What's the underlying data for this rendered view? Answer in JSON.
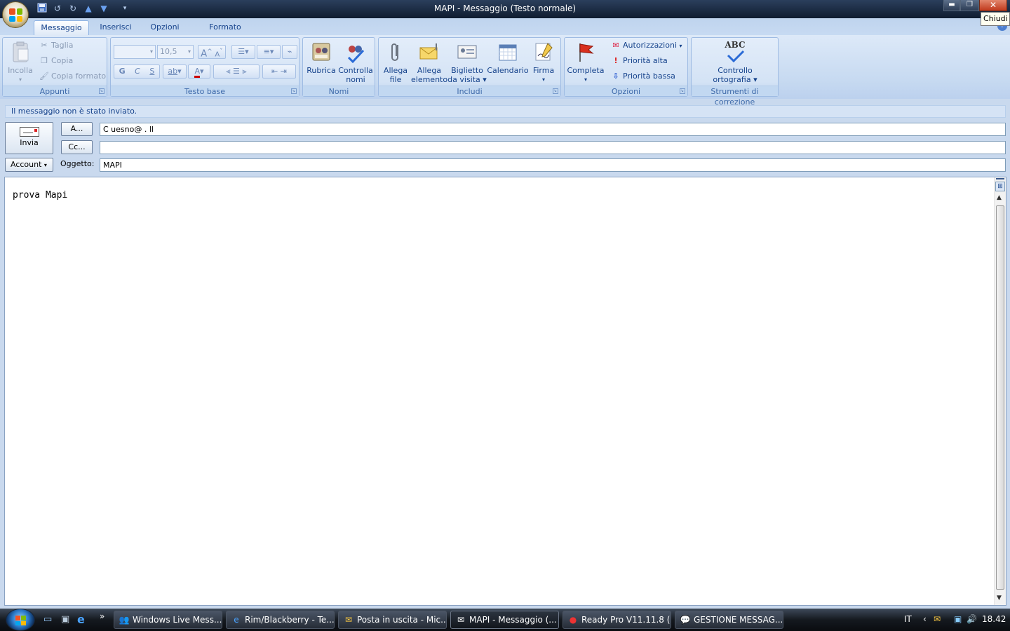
{
  "window": {
    "title": "MAPI - Messaggio (Testo normale)",
    "tooltip": "Chiudi",
    "help_icon": "help-icon"
  },
  "quick_access": [
    "save-icon",
    "undo-icon",
    "redo-icon",
    "up-arrow-icon",
    "down-arrow-icon",
    "customize-icon"
  ],
  "tabs": [
    {
      "label": "Messaggio",
      "active": true
    },
    {
      "label": "Inserisci"
    },
    {
      "label": "Opzioni"
    },
    {
      "label": "Formato testo"
    }
  ],
  "ribbon": {
    "appunti": {
      "label": "Appunti",
      "paste": "Incolla",
      "cut": "Taglia",
      "copy": "Copia",
      "format_painter": "Copia formato"
    },
    "testo_base": {
      "label": "Testo base",
      "font_name": "",
      "font_size": "10,5",
      "bold": "G",
      "italic": "C",
      "strike": "S",
      "grow": "A",
      "shrink": "A",
      "highlight": "ab",
      "font_color": "A"
    },
    "nomi": {
      "label": "Nomi",
      "address_book": "Rubrica",
      "check_names_1": "Controlla",
      "check_names_2": "nomi"
    },
    "includi": {
      "label": "Includi",
      "attach_file_1": "Allega",
      "attach_file_2": "file",
      "attach_item_1": "Allega",
      "attach_item_2": "elemento",
      "business_card_1": "Biglietto",
      "business_card_2": "da visita",
      "calendar": "Calendario",
      "signature": "Firma"
    },
    "opzioni": {
      "label": "Opzioni",
      "follow_up": "Completa",
      "permissions": "Autorizzazioni",
      "high_priority": "Priorità alta",
      "low_priority": "Priorità bassa"
    },
    "correzione": {
      "label": "Strumenti di correzione",
      "abc": "ABC",
      "spelling_1": "Controllo",
      "spelling_2": "ortografia"
    }
  },
  "info_bar": "Il messaggio non è stato inviato.",
  "form": {
    "send": "Invia",
    "to_button": "A...",
    "cc_button": "Cc...",
    "account_button": "Account",
    "subject_label": "Oggetto:",
    "to_value": "C  uesno@   .  ll",
    "cc_value": "",
    "subject_value": "MAPI"
  },
  "body": {
    "text": "prova Mapi"
  },
  "taskbar": {
    "items": [
      {
        "label": "Windows Live Mess...",
        "icon": "messenger-icon"
      },
      {
        "label": "Rim/Blackberry - Te...",
        "icon": "ie-icon"
      },
      {
        "label": "Posta in uscita - Mic...",
        "icon": "outlook-icon"
      },
      {
        "label": "MAPI - Messaggio (...",
        "icon": "mail-icon",
        "active": true
      },
      {
        "label": "Ready Pro V11.11.8 (...",
        "icon": "strawberry-icon"
      },
      {
        "label": "GESTIONE MESSAG...",
        "icon": "message-icon"
      }
    ],
    "language": "IT",
    "clock": "18.42"
  },
  "colors": {
    "ribbon_bg": "#c9d9ee",
    "text_blue": "#15428b",
    "taskbar": "#15191f"
  }
}
